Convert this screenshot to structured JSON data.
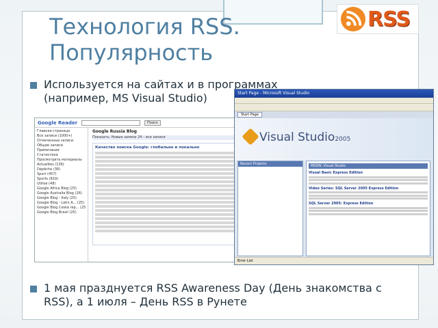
{
  "slide": {
    "title_line1": "Технология RSS.",
    "title_line2": "Популярность",
    "bullet1": "Используется на сайтах и в программах (например, MS Visual Studio)",
    "bullet2": "1 мая празднуется RSS Awareness Day (День знакомства с RSS), а 1 июля – День RSS в Рунете",
    "logo_text": "RSS"
  },
  "reader": {
    "logo": "Google Reader",
    "search_button": "Поиск",
    "blog_title": "Google Russia Blog",
    "sidebar": [
      "Главная страница",
      "Все записи (1000+)",
      "Отмеченные записи",
      "Общие записи",
      "Примечания",
      "Статистика",
      "Просмотреть материалы",
      "Actualités (136)",
      "Dépêche (38)",
      "Sport (457)",
      "Sports (819)",
      "Utilisé (48)",
      "Google Africa Blog (25)",
      "Google Australia Blog (26)",
      "Google Blog - Italy (25)",
      "Google Blog - Latin A... (25)",
      "Google Blog Česká rep... (25)",
      "Google Blog Brasil (25)"
    ],
    "toolbar": "Показать: Новые записи 24 – все записи",
    "article_title": "Качество поиска Google: глобально и локально"
  },
  "vs": {
    "window_title": "Start Page - Microsoft Visual Studio",
    "tab": "Start Page",
    "product": "Visual Studio",
    "year": "2005",
    "recent_projects": "Recent Projects",
    "msdn_news": "MSDN: Visual Studio",
    "news": [
      "Visual Basic Express Edition",
      "Video Series: SQL Server 2005 Express Edition",
      "SQL Server 2005: Express Edition"
    ],
    "status": "Error List"
  },
  "colors": {
    "title": "#4f7fa1",
    "bullet_dot": "#4f7fa1",
    "rss_orange": "#e05a1a"
  }
}
